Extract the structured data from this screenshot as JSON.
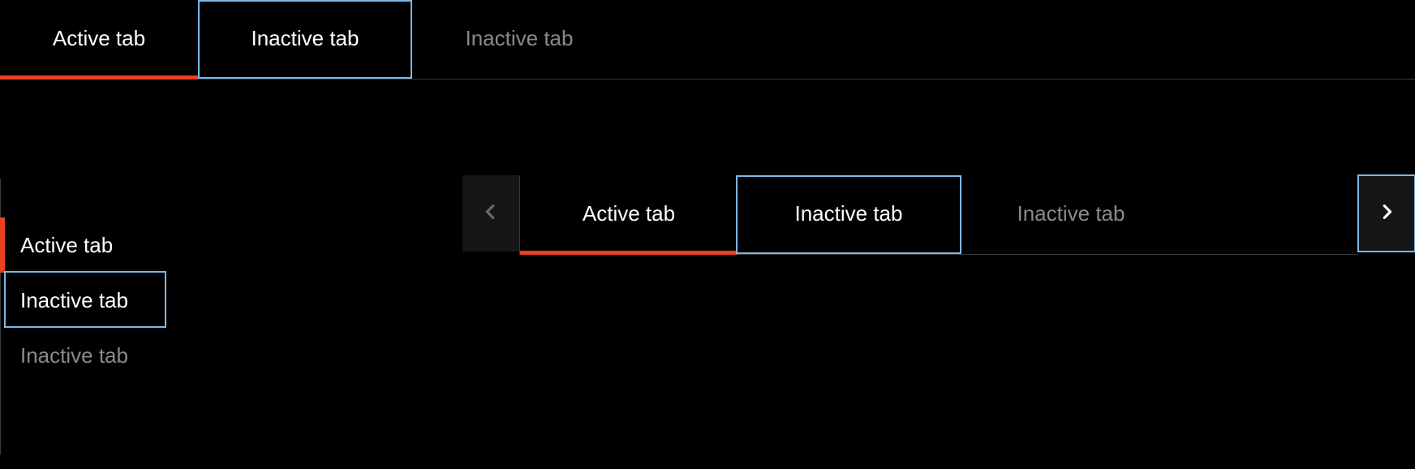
{
  "colors": {
    "background": "#000000",
    "accent": "#ee3f22",
    "focus_outline": "#7cb7e6",
    "text_primary": "#ffffff",
    "text_secondary": "#8a8a8a",
    "divider": "#3a3a3a",
    "button_bg": "#161616"
  },
  "horizontal_tabs": {
    "items": [
      {
        "label": "Active tab",
        "state": "active"
      },
      {
        "label": "Inactive tab",
        "state": "hover"
      },
      {
        "label": "Inactive tab",
        "state": "idle"
      }
    ]
  },
  "vertical_tabs": {
    "items": [
      {
        "label": "Active tab",
        "state": "active"
      },
      {
        "label": "Inactive tab",
        "state": "hover"
      },
      {
        "label": "Inactive tab",
        "state": "idle"
      }
    ]
  },
  "scrollable_tabs": {
    "scroll_left": {
      "icon": "chevron-left",
      "enabled": false
    },
    "scroll_right": {
      "icon": "chevron-right",
      "enabled": true,
      "focused": true
    },
    "items": [
      {
        "label": "Active tab",
        "state": "active"
      },
      {
        "label": "Inactive tab",
        "state": "hover"
      },
      {
        "label": "Inactive tab",
        "state": "idle"
      }
    ]
  }
}
